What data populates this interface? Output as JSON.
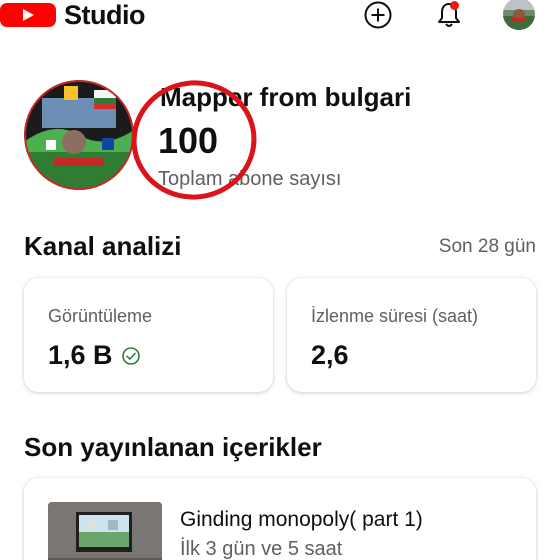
{
  "app": {
    "brand": "Studio",
    "accent_color": "#ff0000"
  },
  "topbar": {
    "icons": [
      "add-circle-icon",
      "bell-icon",
      "account-avatar"
    ],
    "notification_dot_color": "#e61b1b"
  },
  "channel": {
    "name": "Mapper from bulgari",
    "subscriber_count": "100",
    "subscriber_label": "Toplam abone sayısı",
    "highlight_ring_color": "#d9141b"
  },
  "analytics": {
    "title": "Kanal analizi",
    "period": "Son 28 gün",
    "cards": [
      {
        "label": "Görüntüleme",
        "value": "1,6 B",
        "icon": "check-circle-icon"
      },
      {
        "label": "İzlenme süresi (saat)",
        "value": "2,6"
      }
    ]
  },
  "recent": {
    "title": "Son yayınlanan içerikler",
    "items": [
      {
        "title": "Ginding monopoly( part 1)",
        "subtitle": "İlk 3 gün ve 5 saat"
      }
    ]
  }
}
